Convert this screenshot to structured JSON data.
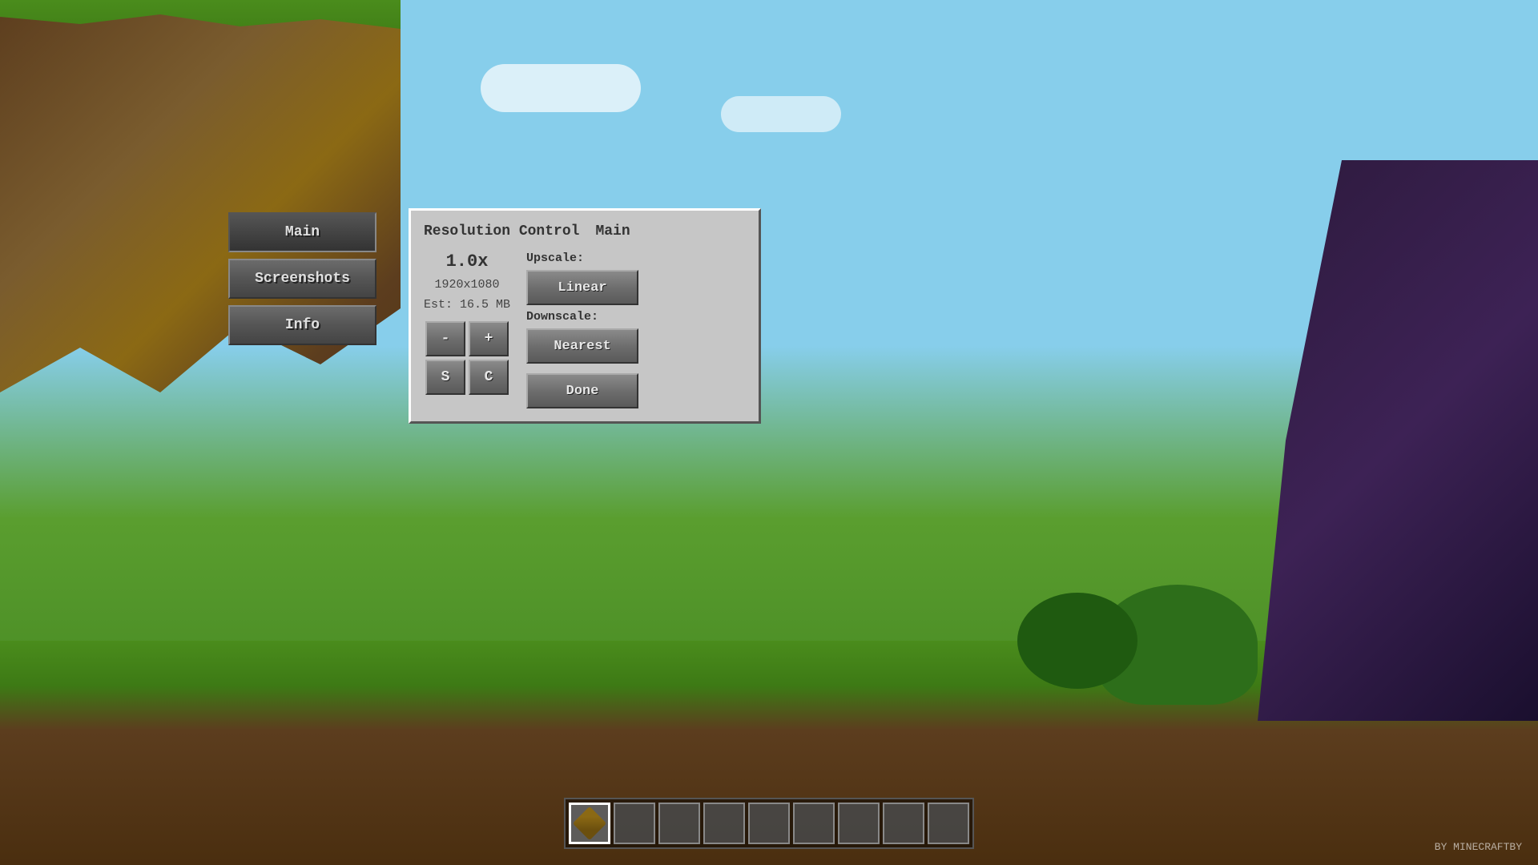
{
  "background": {
    "sky_color": "#87CEEB",
    "ground_color": "#4a8c1c"
  },
  "sidebar": {
    "buttons": [
      {
        "id": "main",
        "label": "Main",
        "active": true
      },
      {
        "id": "screenshots",
        "label": "Screenshots",
        "active": false
      },
      {
        "id": "info",
        "label": "Info",
        "active": false
      }
    ]
  },
  "dialog": {
    "title": "Resolution Control",
    "section": "Main",
    "resolution_value": "1.0x",
    "resolution_dims": "1920x1080",
    "resolution_est": "Est: 16.5 MB",
    "controls": {
      "minus": "-",
      "plus": "+",
      "set": "S",
      "cancel": "C"
    },
    "upscale_label": "Upscale:",
    "upscale_btn": "Linear",
    "downscale_label": "Downscale:",
    "downscale_btn": "Nearest",
    "done_btn": "Done"
  },
  "hotbar": {
    "slots": 9,
    "selected_slot": 0
  },
  "watermark": {
    "text": "BY MINECRAFTBY"
  }
}
